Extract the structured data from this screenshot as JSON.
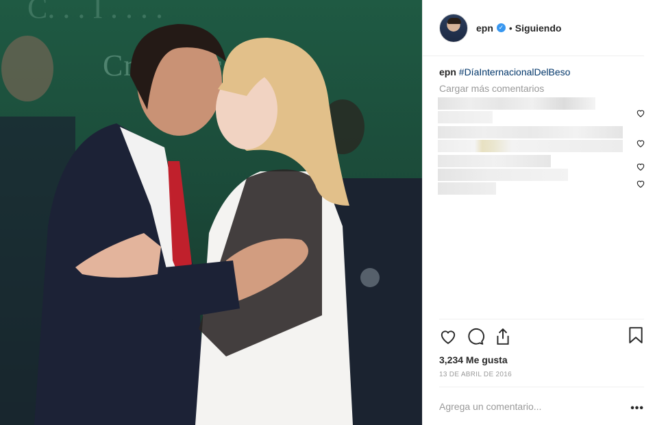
{
  "post": {
    "backdrop_text": "Cr  México,",
    "backdrop_top_text": "C. . . I . . . ."
  },
  "header": {
    "username": "epn",
    "verified_icon": "verified-badge-icon",
    "separator": "•",
    "follow_status": "Siguiendo"
  },
  "caption": {
    "username": "epn",
    "hashtag": "#DíaInternacionalDelBeso"
  },
  "comments": {
    "load_more": "Cargar más comentarios",
    "blurred_count": 4
  },
  "actions": {
    "like_icon": "heart-icon",
    "comment_icon": "comment-bubble-icon",
    "share_icon": "share-icon",
    "save_icon": "bookmark-icon"
  },
  "likes": "3,234 Me gusta",
  "date": "13 DE ABRIL DE 2016",
  "add_comment": {
    "placeholder": "Agrega un comentario...",
    "more_label": "•••"
  },
  "colors": {
    "hashtag": "#003569",
    "verified": "#3897f0",
    "muted": "#999999",
    "photo_bg": "#1f5a43"
  }
}
